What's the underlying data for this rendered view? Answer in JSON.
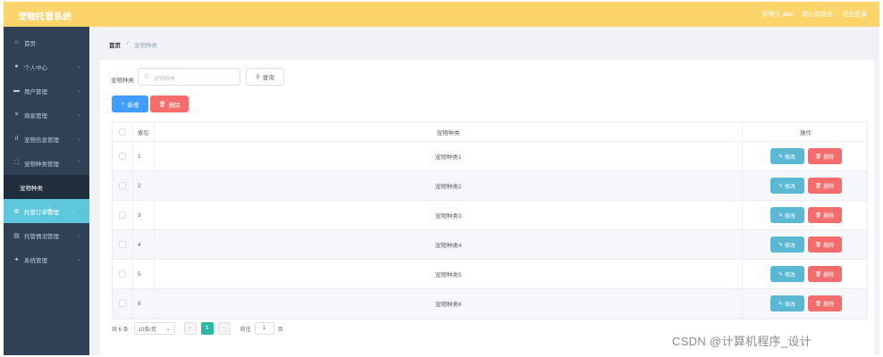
{
  "header": {
    "title": "宠物托管系统",
    "links": [
      "管理员 abo",
      "退出到前台",
      "退出登录"
    ]
  },
  "sidebar": {
    "items": [
      {
        "icon": "home-icon",
        "label": "首页",
        "arrow": ""
      },
      {
        "icon": "user-icon",
        "label": "个人中心",
        "arrow": "⌄"
      },
      {
        "icon": "users-icon",
        "label": "用户管理",
        "arrow": "⌄"
      },
      {
        "icon": "list-icon",
        "label": "商家管理",
        "arrow": "⌄"
      },
      {
        "icon": "chart-icon",
        "label": "宠物信息管理",
        "arrow": "⌄"
      },
      {
        "icon": "category-icon",
        "label": "宠物种类管理",
        "arrow": "⌃"
      },
      {
        "icon": "",
        "label": "宠物种类",
        "arrow": ""
      },
      {
        "icon": "gear-icon",
        "label": "托管订单管理",
        "arrow": "⌄"
      },
      {
        "icon": "doc-icon",
        "label": "托管情况管理",
        "arrow": "⌄"
      },
      {
        "icon": "settings-icon",
        "label": "系统管理",
        "arrow": "⌄"
      }
    ]
  },
  "breadcrumb": {
    "home": "首页",
    "sep": "/",
    "current": "宠物种类"
  },
  "search": {
    "label": "宠物种类",
    "placeholder": "宠物种类",
    "button": "查询"
  },
  "actions": {
    "add": "新增",
    "delete": "删除"
  },
  "table": {
    "headers": {
      "index": "索引",
      "name": "宠物种类",
      "op": "操作"
    },
    "rows": [
      {
        "index": "1",
        "name": "宠物种类1"
      },
      {
        "index": "2",
        "name": "宠物种类2"
      },
      {
        "index": "3",
        "name": "宠物种类3"
      },
      {
        "index": "4",
        "name": "宠物种类4"
      },
      {
        "index": "5",
        "name": "宠物种类5"
      },
      {
        "index": "6",
        "name": "宠物种类6"
      }
    ],
    "edit_label": "修改",
    "delete_label": "删除"
  },
  "pagination": {
    "total": "共 6 条",
    "page_size": "10条/页",
    "prev": "‹",
    "current": "1",
    "next": "›",
    "goto_prefix": "前往",
    "goto_value": "1",
    "goto_suffix": "页"
  },
  "watermark": "CSDN @计算机程序_设计"
}
